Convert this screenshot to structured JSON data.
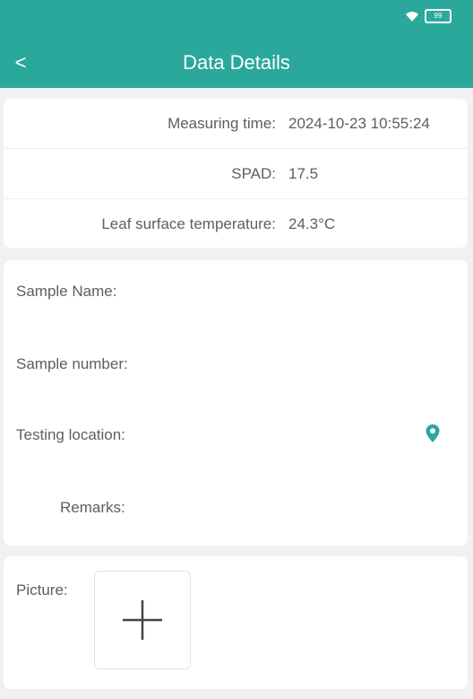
{
  "status_bar": {
    "battery": "99"
  },
  "header": {
    "back_glyph": "<",
    "title": "Data Details"
  },
  "measurement": {
    "rows": [
      {
        "label": "Measuring time:",
        "value": "2024-10-23 10:55:24"
      },
      {
        "label": "SPAD:",
        "value": "17.5"
      },
      {
        "label": "Leaf surface temperature:",
        "value": "24.3°C"
      }
    ]
  },
  "form": {
    "sample_name_label": "Sample Name:",
    "sample_number_label": "Sample number:",
    "testing_location_label": "Testing location:",
    "remarks_label": "Remarks:"
  },
  "picture": {
    "label": "Picture:"
  },
  "icons": {
    "back": "chevron-left-icon",
    "location": "location-pin-icon",
    "add": "plus-icon",
    "wifi": "wifi-icon",
    "battery": "battery-icon"
  },
  "colors": {
    "accent": "#2aa89b",
    "background": "#f1f1f1",
    "card": "#ffffff"
  }
}
